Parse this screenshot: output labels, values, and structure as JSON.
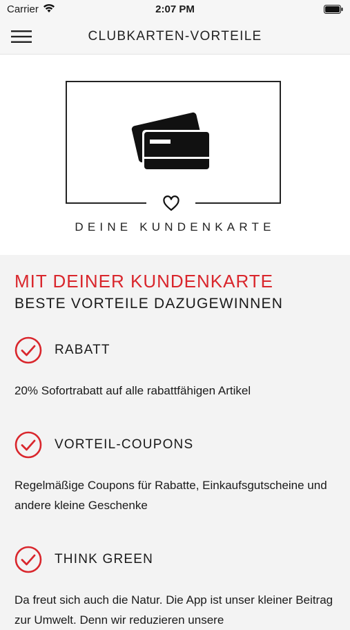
{
  "status_bar": {
    "carrier": "Carrier",
    "time": "2:07 PM"
  },
  "nav": {
    "title": "CLUBKARTEN-VORTEILE",
    "menu_icon": "hamburger-menu-icon"
  },
  "hero": {
    "caption": "DEINE KUNDENKARTE",
    "icons": [
      "credit-cards-icon",
      "heart-icon"
    ]
  },
  "intro": {
    "headline_red": "MIT DEINER KUNDENKARTE",
    "headline_dark": "BESTE VORTEILE DAZUGEWINNEN"
  },
  "features": [
    {
      "title": "RABATT",
      "description": "20% Sofortrabatt auf alle rabattfähigen Artikel"
    },
    {
      "title": "VORTEIL-COUPONS",
      "description": "Regelmäßige Coupons für Rabatte, Einkaufsgutscheine und andere kleine Geschenke"
    },
    {
      "title": "THINK GREEN",
      "description": "Da freut sich auch die Natur. Die App ist unser kleiner Beitrag zur Umwelt. Denn wir reduzieren unsere"
    }
  ],
  "colors": {
    "accent_red": "#d9262c",
    "background": "#f3f3f3",
    "hero_background": "#ffffff",
    "text": "#1a1a1a"
  }
}
